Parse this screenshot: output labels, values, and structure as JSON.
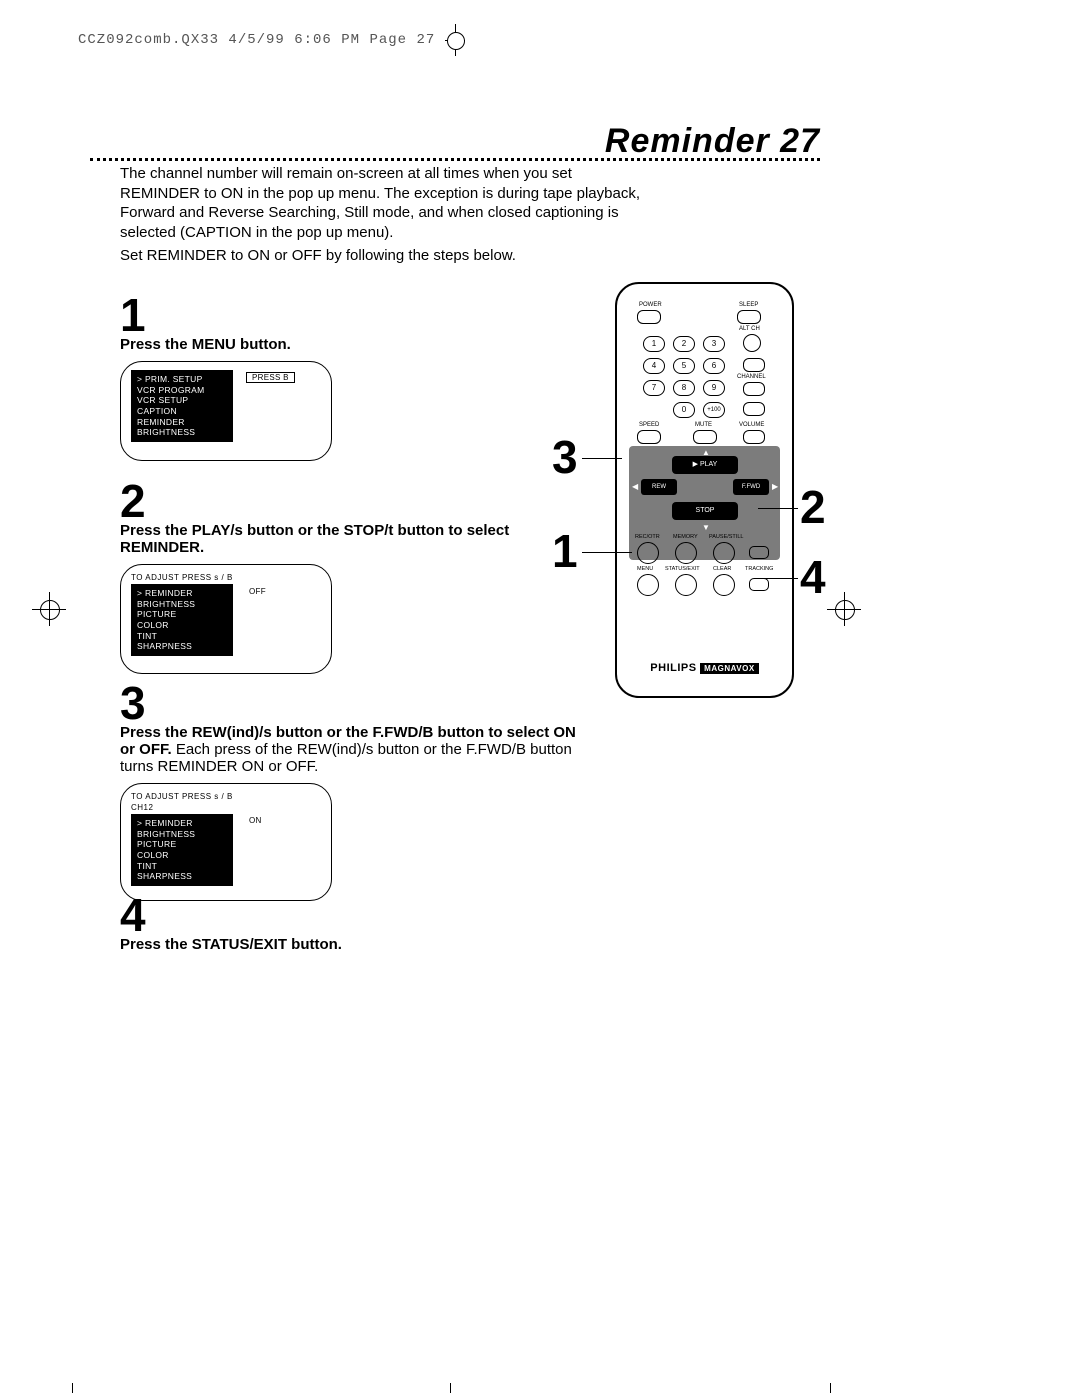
{
  "header": "CCZ092comb.QX33  4/5/99 6:06 PM  Page 27",
  "title": "Reminder 27",
  "intro_p1": "The channel number will remain on-screen at all times when you set REMINDER to ON in the pop up menu. The exception is during tape playback, Forward and Reverse Searching, Still mode, and when closed captioning is selected (CAPTION in the pop up menu).",
  "intro_p2": "Set REMINDER to ON or OFF by following the steps below.",
  "steps": {
    "s1": {
      "num": "1",
      "text": "Press the MENU button."
    },
    "s2": {
      "num": "2",
      "text_a": "Press the PLAY/",
      "sym1": "s",
      "text_b": " button or the STOP/",
      "sym2": "t",
      "text_c": " button to select REMINDER."
    },
    "s3": {
      "num": "3",
      "text_a": "Press the REW(ind)/",
      "sym1": "s",
      "text_b": " button or the F.FWD/",
      "sym2": "B",
      "text_c": " button to select ON or OFF.",
      "plain": " Each press of the REW(ind)/s  button or the F.FWD/B  button turns REMINDER ON or OFF."
    },
    "s4": {
      "num": "4",
      "text": "Press the STATUS/EXIT button."
    }
  },
  "osd1": {
    "btn": "PRESS B",
    "items": [
      "PRIM. SETUP",
      "VCR PROGRAM",
      "VCR SETUP",
      "CAPTION",
      "REMINDER",
      "BRIGHTNESS"
    ]
  },
  "osd2": {
    "note": "TO ADJUST PRESS s  / B",
    "value": "OFF",
    "items": [
      "REMINDER",
      "BRIGHTNESS",
      "PICTURE",
      "COLOR",
      "TINT",
      "SHARPNESS"
    ]
  },
  "osd3": {
    "note1": "TO ADJUST PRESS s  / B",
    "note2": "CH12",
    "value": "ON",
    "items": [
      "REMINDER",
      "BRIGHTNESS",
      "PICTURE",
      "COLOR",
      "TINT",
      "SHARPNESS"
    ]
  },
  "remote": {
    "power": "POWER",
    "sleep": "SLEEP",
    "altch": "ALT CH",
    "channel": "CHANNEL",
    "speed": "SPEED",
    "mute": "MUTE",
    "volume": "VOLUME",
    "play": "▶ PLAY",
    "rew": "REW",
    "ffwd": "F.FWD",
    "stop": "STOP",
    "recotr": "REC/OTR",
    "memory": "MEMORY",
    "pausestill": "PAUSE/STILL",
    "menu": "MENU",
    "status": "STATUS/EXIT",
    "clear": "CLEAR",
    "tracking": "TRACKING",
    "brand1": "PHILIPS",
    "brand2": "MAGNAVOX",
    "plus100": "+100",
    "num": [
      "1",
      "2",
      "3",
      "4",
      "5",
      "6",
      "7",
      "8",
      "9",
      "0"
    ]
  },
  "callouts": {
    "c1": "1",
    "c2": "2",
    "c3": "3",
    "c4": "4"
  }
}
